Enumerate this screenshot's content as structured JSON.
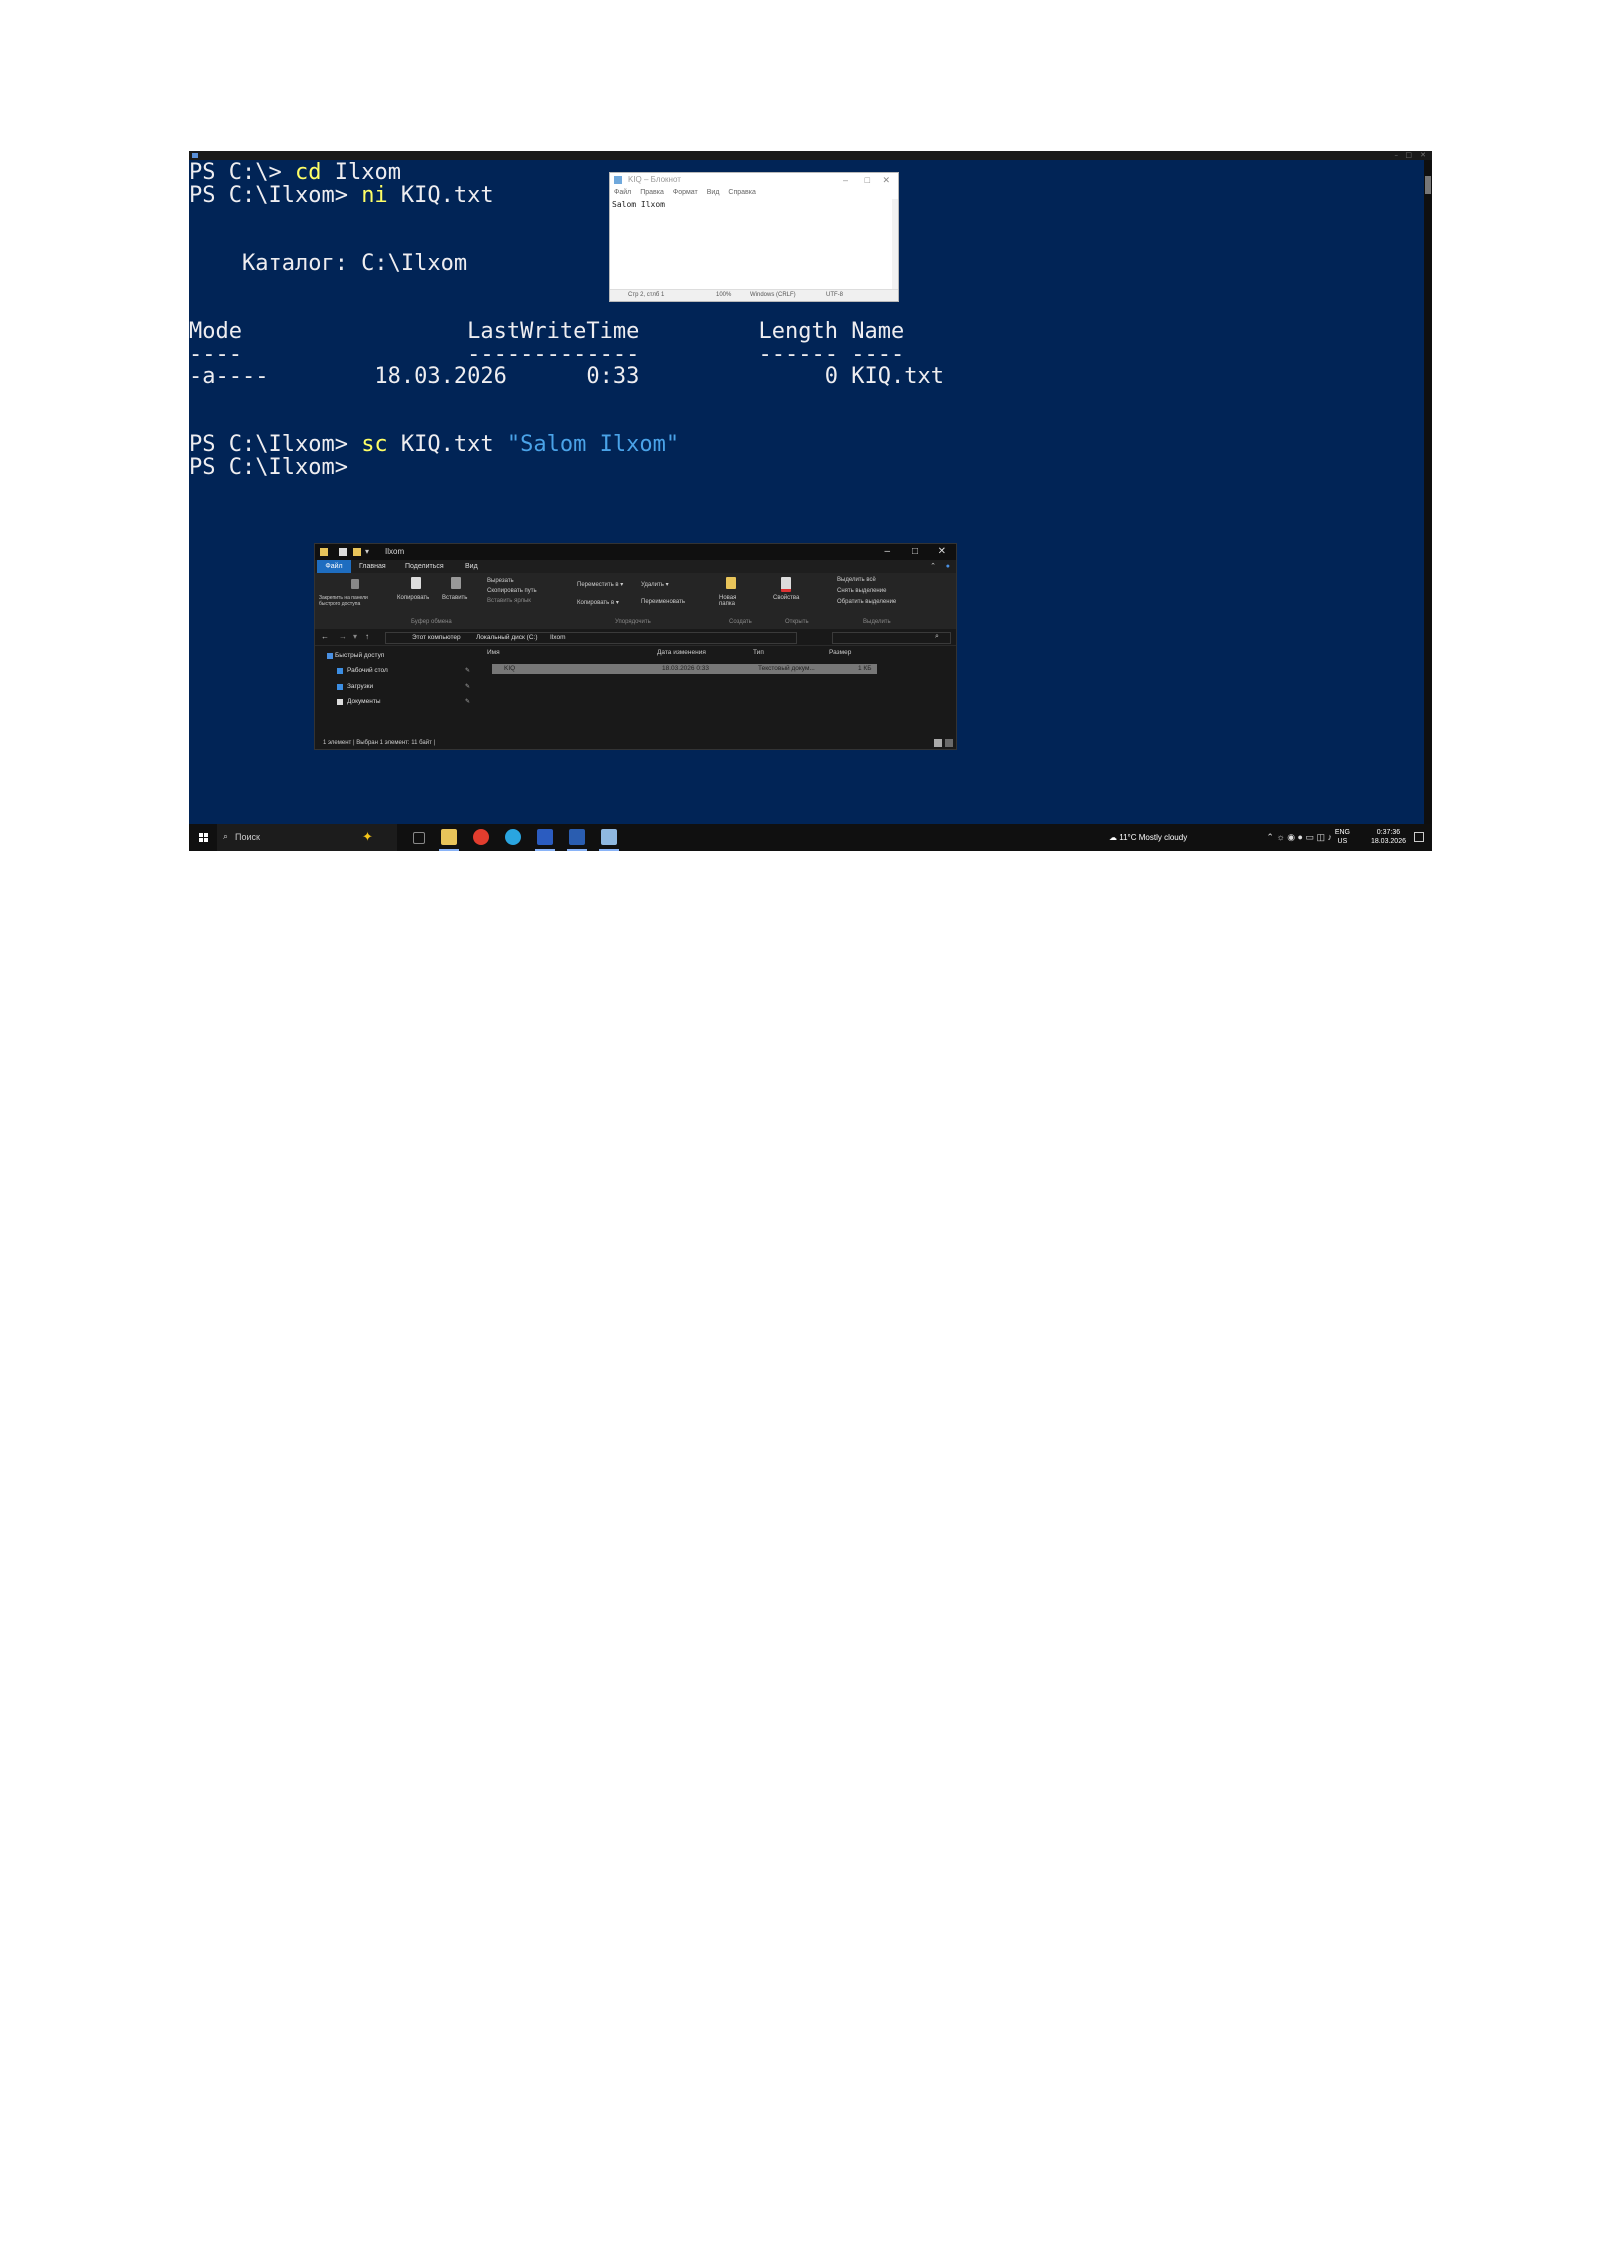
{
  "powershell": {
    "lines": [
      {
        "prompt": "PS C:\\> ",
        "cmd": "cd",
        "args": " Ilxom",
        "str": ""
      },
      {
        "prompt": "PS C:\\Ilxom> ",
        "cmd": "ni",
        "args": " KIQ.txt",
        "str": ""
      },
      {
        "prompt": "",
        "cmd": "",
        "args": "",
        "str": ""
      },
      {
        "prompt": "",
        "cmd": "",
        "args": "",
        "str": ""
      },
      {
        "prompt": "    Каталог: C:\\Ilxom",
        "cmd": "",
        "args": "",
        "str": ""
      },
      {
        "prompt": "",
        "cmd": "",
        "args": "",
        "str": ""
      },
      {
        "prompt": "",
        "cmd": "",
        "args": "",
        "str": ""
      },
      {
        "prompt": "Mode                 LastWriteTime         Length Name",
        "cmd": "",
        "args": "",
        "str": ""
      },
      {
        "prompt": "----                 -------------         ------ ----",
        "cmd": "",
        "args": "",
        "str": ""
      },
      {
        "prompt": "-a----        18.03.2026      0:33              0 KIQ.txt",
        "cmd": "",
        "args": "",
        "str": ""
      },
      {
        "prompt": "",
        "cmd": "",
        "args": "",
        "str": ""
      },
      {
        "prompt": "",
        "cmd": "",
        "args": "",
        "str": ""
      },
      {
        "prompt": "PS C:\\Ilxom> ",
        "cmd": "sc",
        "args": " KIQ.txt ",
        "str": "\"Salom Ilxom\""
      },
      {
        "prompt": "PS C:\\Ilxom> ",
        "cmd": "",
        "args": "",
        "str": ""
      }
    ]
  },
  "notepad": {
    "title": "KIQ – Блокнот",
    "menu": [
      "Файл",
      "Правка",
      "Формат",
      "Вид",
      "Справка"
    ],
    "content": "Salom Ilxom",
    "status": {
      "position": "Стр 2, стлб 1",
      "zoom": "100%",
      "eol": "Windows (CRLF)",
      "encoding": "UTF-8"
    }
  },
  "explorer": {
    "title": "Ilxom",
    "tabs": {
      "file": "Файл",
      "home": "Главная",
      "share": "Поделиться",
      "view": "Вид"
    },
    "ribbon": {
      "pin": "Закрепить на панели быстрого доступа",
      "copy": "Копировать",
      "paste": "Вставить",
      "cut": "Вырезать",
      "copy_path": "Скопировать путь",
      "paste_shortcut": "Вставить ярлык",
      "move_to": "Переместить в ▾",
      "copy_to": "Копировать в ▾",
      "delete": "Удалить ▾",
      "rename": "Переименовать",
      "new_folder": "Новая папка",
      "properties": "Свойства",
      "select_all": "Выделить всё",
      "select_none": "Снять выделение",
      "invert_selection": "Обратить выделение",
      "group_clipboard": "Буфер обмена",
      "group_organize": "Упорядочить",
      "group_new": "Создать",
      "group_open": "Открыть",
      "group_select": "Выделить"
    },
    "breadcrumb": {
      "pc": "Этот компьютер",
      "disk": "Локальный диск (C:)",
      "folder": "Ilxom"
    },
    "nav": {
      "quick": "Быстрый доступ",
      "desktop": "Рабочий стол",
      "downloads": "Загрузки",
      "documents": "Документы"
    },
    "columns": {
      "name": "Имя",
      "date": "Дата изменения",
      "type": "Тип",
      "size": "Размер"
    },
    "row": {
      "name": "KIQ",
      "date": "18.03.2026 0:33",
      "type": "Текстовый докум...",
      "size": "1 КБ"
    },
    "status": "1 элемент  |  Выбран 1 элемент: 11 байт  |"
  },
  "taskbar": {
    "search_placeholder": "Поиск",
    "weather": "11°C  Mostly cloudy",
    "lang_top": "ENG",
    "lang_bottom": "US",
    "time": "0:37:36",
    "date": "18.03.2026"
  },
  "colors": {
    "ps_background": "#012456",
    "ps_text": "#eeedf0",
    "ps_command": "#ffff66",
    "ps_string": "#4aa3e8"
  }
}
